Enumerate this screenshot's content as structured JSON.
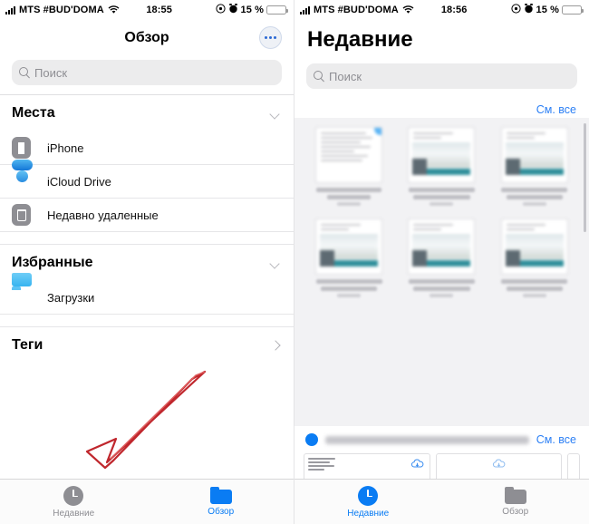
{
  "left": {
    "status": {
      "carrier": "MTS #BUD'DOMA",
      "time": "18:55",
      "battery": "15 %",
      "signal_icon": "cellular-bars-icon",
      "wifi_icon": "wifi-icon",
      "battery_icon": "battery-icon",
      "alarm_icon": "alarm-clock-icon",
      "lock_icon": "rotation-lock-icon"
    },
    "nav": {
      "title": "Обзор",
      "more_label": "more-button"
    },
    "search": {
      "placeholder": "Поиск"
    },
    "sections": [
      {
        "title": "Места",
        "chevron": "chevron-down-icon",
        "items": [
          {
            "label": "iPhone",
            "icon": "iphone-icon"
          },
          {
            "label": "iCloud Drive",
            "icon": "icloud-icon"
          },
          {
            "label": "Недавно удаленные",
            "icon": "trash-icon"
          }
        ]
      },
      {
        "title": "Избранные",
        "chevron": "chevron-down-icon",
        "items": [
          {
            "label": "Загрузки",
            "icon": "downloads-folder-icon"
          }
        ]
      },
      {
        "title": "Теги",
        "chevron": "chevron-right-icon",
        "items": []
      }
    ],
    "tabs": [
      {
        "label": "Недавние",
        "icon": "clock-icon",
        "active": false
      },
      {
        "label": "Обзор",
        "icon": "folder-icon",
        "active": true
      }
    ]
  },
  "right": {
    "status": {
      "carrier": "MTS #BUD'DOMA",
      "time": "18:56",
      "battery": "15 %",
      "signal_icon": "cellular-bars-icon",
      "wifi_icon": "wifi-icon",
      "battery_icon": "battery-icon",
      "alarm_icon": "alarm-clock-icon",
      "lock_icon": "rotation-lock-icon"
    },
    "title": "Недавние",
    "search": {
      "placeholder": "Поиск"
    },
    "see_all_top": "См. все",
    "see_all_bottom": "См. все",
    "tabs": [
      {
        "label": "Недавние",
        "icon": "clock-icon",
        "active": true
      },
      {
        "label": "Обзор",
        "icon": "folder-icon",
        "active": false
      }
    ]
  },
  "annotation": {
    "type": "red-arrow",
    "color": "#c0272d",
    "points_to": "recents-tab"
  },
  "colors": {
    "accent": "#0a7cf3",
    "link": "#2b7ff5",
    "inactive": "#8e8e93",
    "battery_fill": "#fbd34d",
    "panel_bg": "#f2f2f4"
  }
}
